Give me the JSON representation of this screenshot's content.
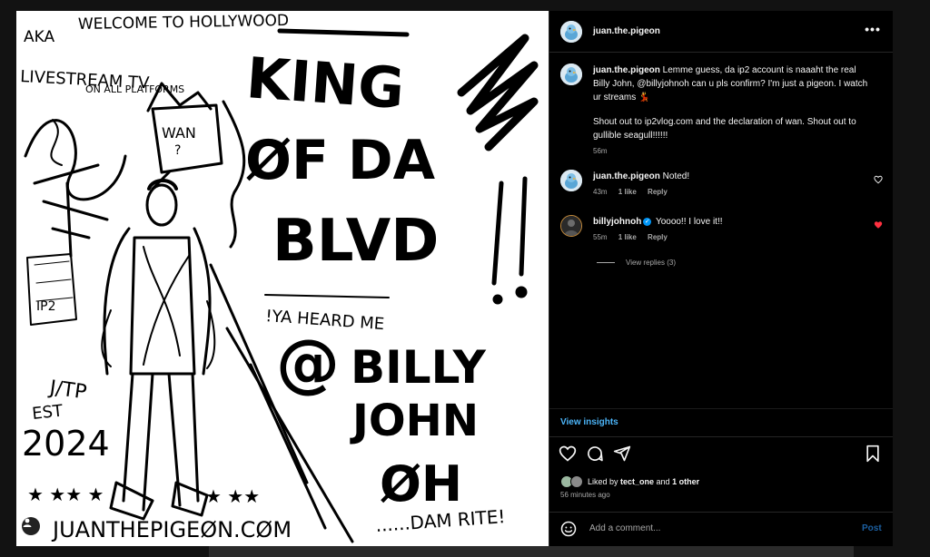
{
  "post": {
    "author": "juan.the.pigeon",
    "caption": {
      "username": "juan.the.pigeon",
      "text": "Lemme guess, da ip2 account is naaaht the real Billy John, @billyjohnoh can u pls confirm? I'm just a pigeon. I watch ur streams 💃",
      "text2": "Shout out to ip2vlog.com and the declaration of wan. Shout out to gullible seagull!!!!!!",
      "time": "56m"
    },
    "comments": [
      {
        "username": "juan.the.pigeon",
        "text": "Noted!",
        "time": "43m",
        "likes": "1 like",
        "reply": "Reply",
        "liked": false
      },
      {
        "username": "billyjohnoh",
        "text": "Yoooo!! I love it!!",
        "time": "55m",
        "likes": "1 like",
        "reply": "Reply",
        "liked": true,
        "verified": true
      }
    ],
    "view_replies": "View replies (3)",
    "insights_label": "View insights",
    "liked_by_prefix": "Liked by ",
    "liked_by_user": "tect_one",
    "liked_by_and": " and ",
    "liked_by_others": "1 other",
    "posted_ago": "56 minutes ago",
    "add_comment_placeholder": "Add a comment...",
    "post_button": "Post"
  },
  "artwork": {
    "welcome": "WELCOME TO HOLLYWOOD",
    "aka": "AKA",
    "livestream": "LIVESTREAM TV",
    "platforms": "ON ALL PLATFORMS",
    "wan": "WAN",
    "wan_q": "?",
    "king1": "KING",
    "king2": "ØF DA",
    "king3": "BLVD",
    "heard": "!YA HEARD ME",
    "at": "@",
    "billy": "BILLY",
    "john": "JOHN",
    "oh": "ØH",
    "jtp": "J/TP",
    "est": "EST",
    "year": "2024",
    "ip2": "IP2",
    "site": "JUANTHEPIGEØN.CØM",
    "damrite": "......DAM RITE!",
    "stars_left": "★ ★★ ★",
    "stars_right": "★ ★★"
  },
  "colors": {
    "accent_link": "#4cb5f9",
    "post_disabled": "#1c5fa0",
    "liked_heart": "#ff3040",
    "verified": "#0095f6",
    "muted": "#a8a8a8"
  },
  "icons": [
    "pigeon-avatar",
    "more-icon",
    "heart-icon",
    "comment-icon",
    "share-icon",
    "bookmark-icon",
    "emoji-icon",
    "user-tag-icon",
    "verified-icon"
  ]
}
